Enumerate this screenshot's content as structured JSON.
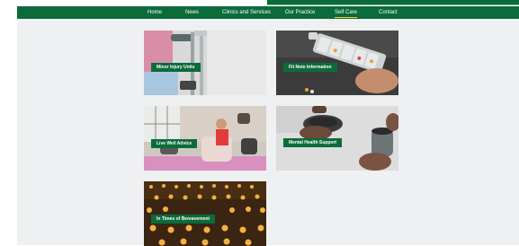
{
  "nav": {
    "items": [
      {
        "label": "Home"
      },
      {
        "label": "News"
      },
      {
        "label": "Clinics and Services"
      },
      {
        "label": "Our Practice"
      },
      {
        "label": "Self Care",
        "active": true
      },
      {
        "label": "Contact"
      }
    ]
  },
  "cards": [
    {
      "label": "Minor Injury Units",
      "image": "crutches-photo"
    },
    {
      "label": "Fit Note Information",
      "image": "pill-organizer-photo"
    },
    {
      "label": "Live Well Advice",
      "image": "exercise-class-photo"
    },
    {
      "label": "Mental Health Support",
      "image": "coffee-cups-photo"
    },
    {
      "label": "In Times of Bereavement",
      "image": "candles-photo"
    }
  ],
  "colors": {
    "brand_green": "#0b6b3a",
    "active_underline": "#f4d233",
    "background": "#eef0f1"
  }
}
